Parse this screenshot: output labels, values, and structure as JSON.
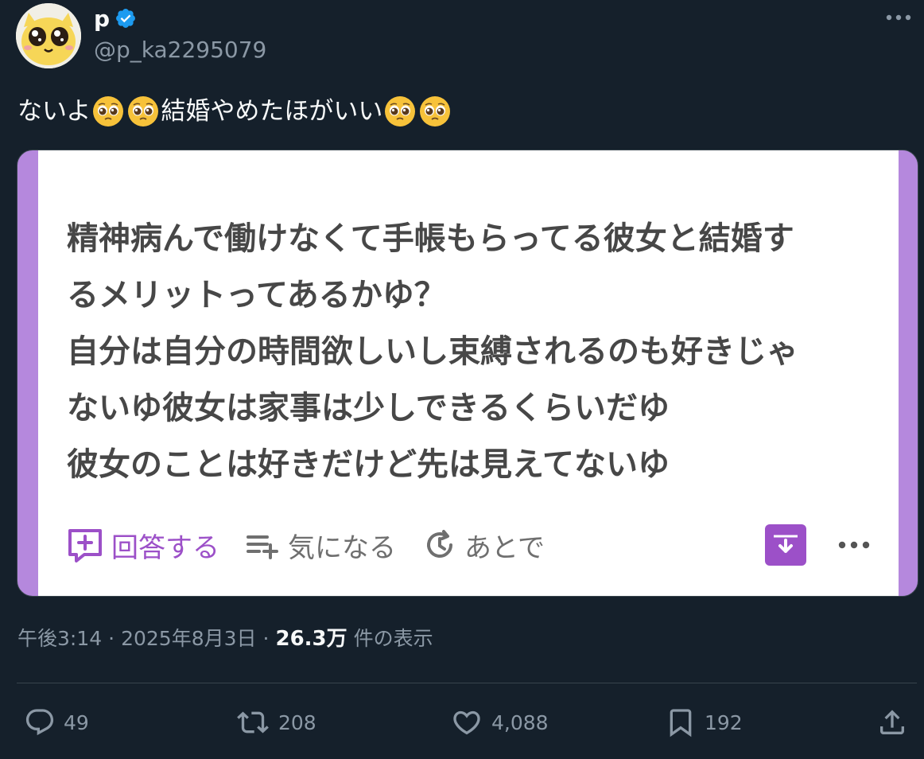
{
  "author": {
    "display_name": "p",
    "handle": "@p_ka2295079",
    "verified": true
  },
  "tweet": {
    "text_parts": [
      "ないよ",
      "結婚やめたほがいい"
    ],
    "emoji": "pleading-face-with-tears"
  },
  "media": {
    "question_lines": [
      "精神病んで働けなくて手帳もらってる彼女と結婚す",
      "るメリットってあるかゆ？",
      "自分は自分の時間欲しいし束縛されるのも好きじゃ",
      "ないゆ彼女は家事は少しできるくらいだゆ",
      "彼女のことは好きだけど先は見えてないゆ"
    ],
    "actions": {
      "answer_label": "回答する",
      "curious_label": "気になる",
      "later_label": "あとで"
    },
    "colors": {
      "accent": "#9c50c8",
      "border_band": "#b588dd"
    }
  },
  "meta": {
    "time": "午後3:14",
    "separator": "·",
    "date": "2025年8月3日",
    "views_count": "26.3万",
    "views_label": "件の表示"
  },
  "stats": {
    "replies": "49",
    "reposts": "208",
    "likes": "4,088",
    "bookmarks": "192"
  },
  "colors": {
    "background": "#15202b",
    "text": "#f7f9f9",
    "muted": "#8b98a5",
    "verified": "#1d9bf0"
  }
}
